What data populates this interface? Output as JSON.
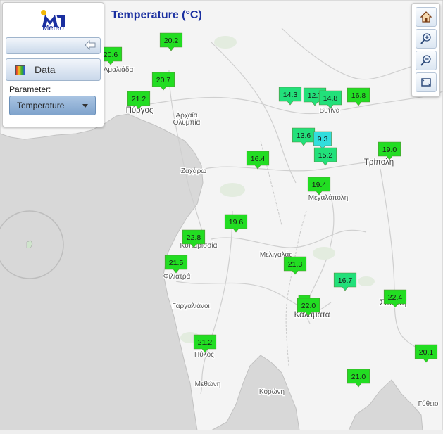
{
  "map_title": "Temperature (°C)",
  "logo_text": "Meteo",
  "data_button_label": "Data",
  "parameter_label": "Parameter:",
  "parameter_value": "Temperature",
  "toolbar": [
    "home-icon",
    "zoom-in-icon",
    "zoom-out-icon",
    "fullscreen-icon"
  ],
  "colors": {
    "title": "#1a2fa0",
    "marker_green": "#22dd22",
    "marker_teal": "#22e07a",
    "marker_cyan": "#33dddd",
    "sea": "#d6d6d6",
    "land": "#f3f3f3"
  },
  "places": [
    {
      "name": "Πύργος",
      "big": true
    },
    {
      "name": "Αμαλιάδα",
      "big": false
    },
    {
      "name": "Αρχαία",
      "big": false
    },
    {
      "name": "Ολυμπία",
      "big": false
    },
    {
      "name": "Βυτίνα",
      "big": false
    },
    {
      "name": "Τρίπολη",
      "big": true
    },
    {
      "name": "Ζαχάρω",
      "big": false
    },
    {
      "name": "Μεγαλόπολη",
      "big": false
    },
    {
      "name": "Κυπαρισσία",
      "big": false
    },
    {
      "name": "Μελιγαλάς",
      "big": false
    },
    {
      "name": "Φιλιατρά",
      "big": false
    },
    {
      "name": "Γαργαλιάνοι",
      "big": false
    },
    {
      "name": "Καλαμάτα",
      "big": true
    },
    {
      "name": "Σπάρτη",
      "big": true
    },
    {
      "name": "Πύλος",
      "big": false
    },
    {
      "name": "Μεθώνη",
      "big": false
    },
    {
      "name": "Κορώνη",
      "big": false
    },
    {
      "name": "Γύθειο",
      "big": false
    }
  ],
  "stations": [
    {
      "value": "20.6",
      "color": "green"
    },
    {
      "value": "20.2",
      "color": "green"
    },
    {
      "value": "20.7",
      "color": "green"
    },
    {
      "value": "21.2",
      "color": "green"
    },
    {
      "value": "14.3",
      "color": "teal"
    },
    {
      "value": "12.7",
      "color": "teal"
    },
    {
      "value": "14.8",
      "color": "teal"
    },
    {
      "value": "16.8",
      "color": "green"
    },
    {
      "value": "13.6",
      "color": "teal"
    },
    {
      "value": "9.3",
      "color": "cyan"
    },
    {
      "value": "15.2",
      "color": "teal"
    },
    {
      "value": "19.0",
      "color": "green"
    },
    {
      "value": "16.4",
      "color": "green"
    },
    {
      "value": "19.4",
      "color": "green"
    },
    {
      "value": "19.6",
      "color": "green"
    },
    {
      "value": "22.8",
      "color": "green"
    },
    {
      "value": "21.5",
      "color": "green"
    },
    {
      "value": "21.3",
      "color": "green"
    },
    {
      "value": "16.7",
      "color": "teal"
    },
    {
      "value": "22.4",
      "color": "green"
    },
    {
      "value": "2",
      "color": "green"
    },
    {
      "value": "22.0",
      "color": "green"
    },
    {
      "value": "21.2",
      "color": "green"
    },
    {
      "value": "20.1",
      "color": "green"
    },
    {
      "value": "21.0",
      "color": "green"
    }
  ]
}
